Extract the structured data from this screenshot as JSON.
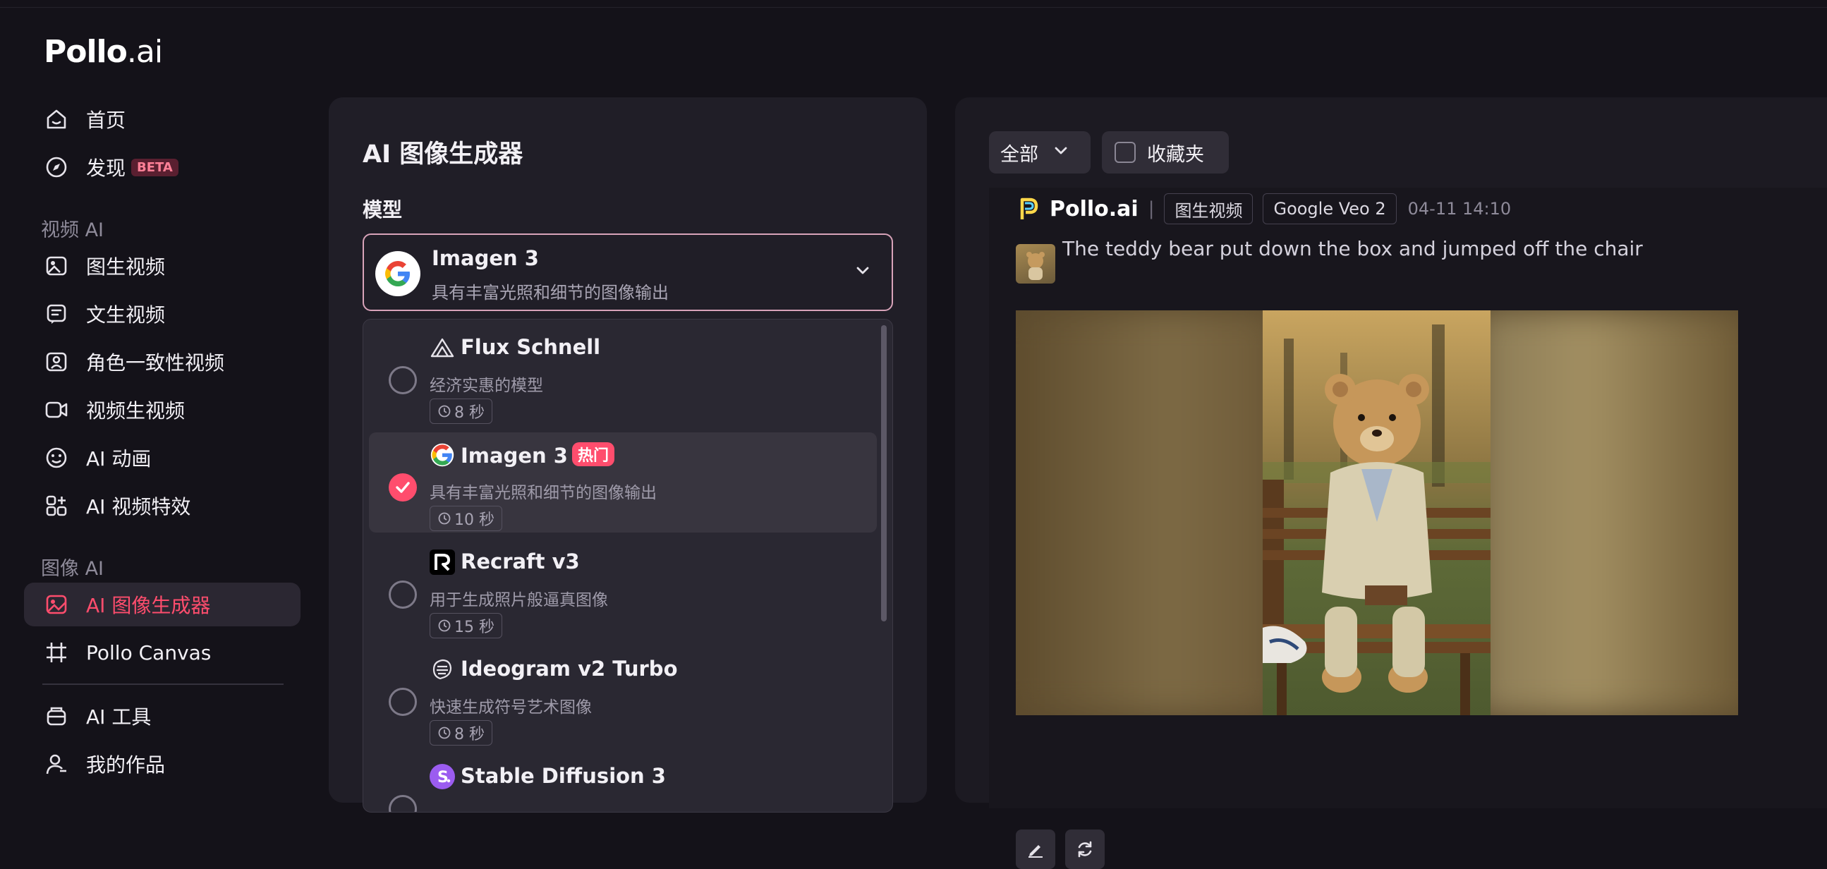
{
  "app": {
    "logo_main": "Pollo",
    "logo_suffix": ".ai"
  },
  "sidebar": {
    "items": [
      {
        "label": "首页",
        "icon": "home-icon"
      },
      {
        "label": "发现",
        "icon": "compass-icon",
        "badge": "BETA"
      }
    ],
    "sections": [
      {
        "title": "视频 AI",
        "items": [
          {
            "label": "图生视频",
            "icon": "image-to-video-icon"
          },
          {
            "label": "文生视频",
            "icon": "text-to-video-icon"
          },
          {
            "label": "角色一致性视频",
            "icon": "character-video-icon"
          },
          {
            "label": "视频生视频",
            "icon": "video-to-video-icon"
          },
          {
            "label": "AI 动画",
            "icon": "animation-icon"
          },
          {
            "label": "AI 视频特效",
            "icon": "effects-icon"
          }
        ]
      },
      {
        "title": "图像 AI",
        "items": [
          {
            "label": "AI 图像生成器",
            "icon": "image-generator-icon",
            "active": true
          },
          {
            "label": "Pollo Canvas",
            "icon": "canvas-icon"
          }
        ]
      }
    ],
    "bottom_items": [
      {
        "label": "AI 工具",
        "icon": "tools-icon"
      },
      {
        "label": "我的作品",
        "icon": "works-icon"
      }
    ]
  },
  "generator": {
    "title": "AI 图像生成器",
    "model_label": "模型",
    "selected_model": {
      "name": "Imagen 3",
      "description": "具有丰富光照和细节的图像输出",
      "icon": "google-icon"
    },
    "options": [
      {
        "name": "Flux Schnell",
        "description": "经济实惠的模型",
        "time": "8 秒",
        "icon": "flux-icon",
        "selected": false
      },
      {
        "name": "Imagen 3",
        "description": "具有丰富光照和细节的图像输出",
        "time": "10 秒",
        "icon": "google-icon",
        "badge": "热门",
        "selected": true
      },
      {
        "name": "Recraft v3",
        "description": "用于生成照片般逼真图像",
        "time": "15 秒",
        "icon": "recraft-icon",
        "selected": false
      },
      {
        "name": "Ideogram v2 Turbo",
        "description": "快速生成符号艺术图像",
        "time": "8 秒",
        "icon": "ideogram-icon",
        "selected": false
      },
      {
        "name": "Stable Diffusion 3",
        "icon": "stable-diffusion-icon",
        "selected": false
      }
    ]
  },
  "results": {
    "filter_label": "全部",
    "favorites_label": "收藏夹",
    "card": {
      "brand": "Pollo.ai",
      "separator": "|",
      "tags": [
        "图生视频",
        "Google Veo 2"
      ],
      "timestamp": "04-11 14:10",
      "prompt": "The teddy bear put down the box and jumped off the chair"
    }
  },
  "colors": {
    "accent": "#ff4d6d",
    "background": "#141219",
    "panel": "#201e27"
  }
}
